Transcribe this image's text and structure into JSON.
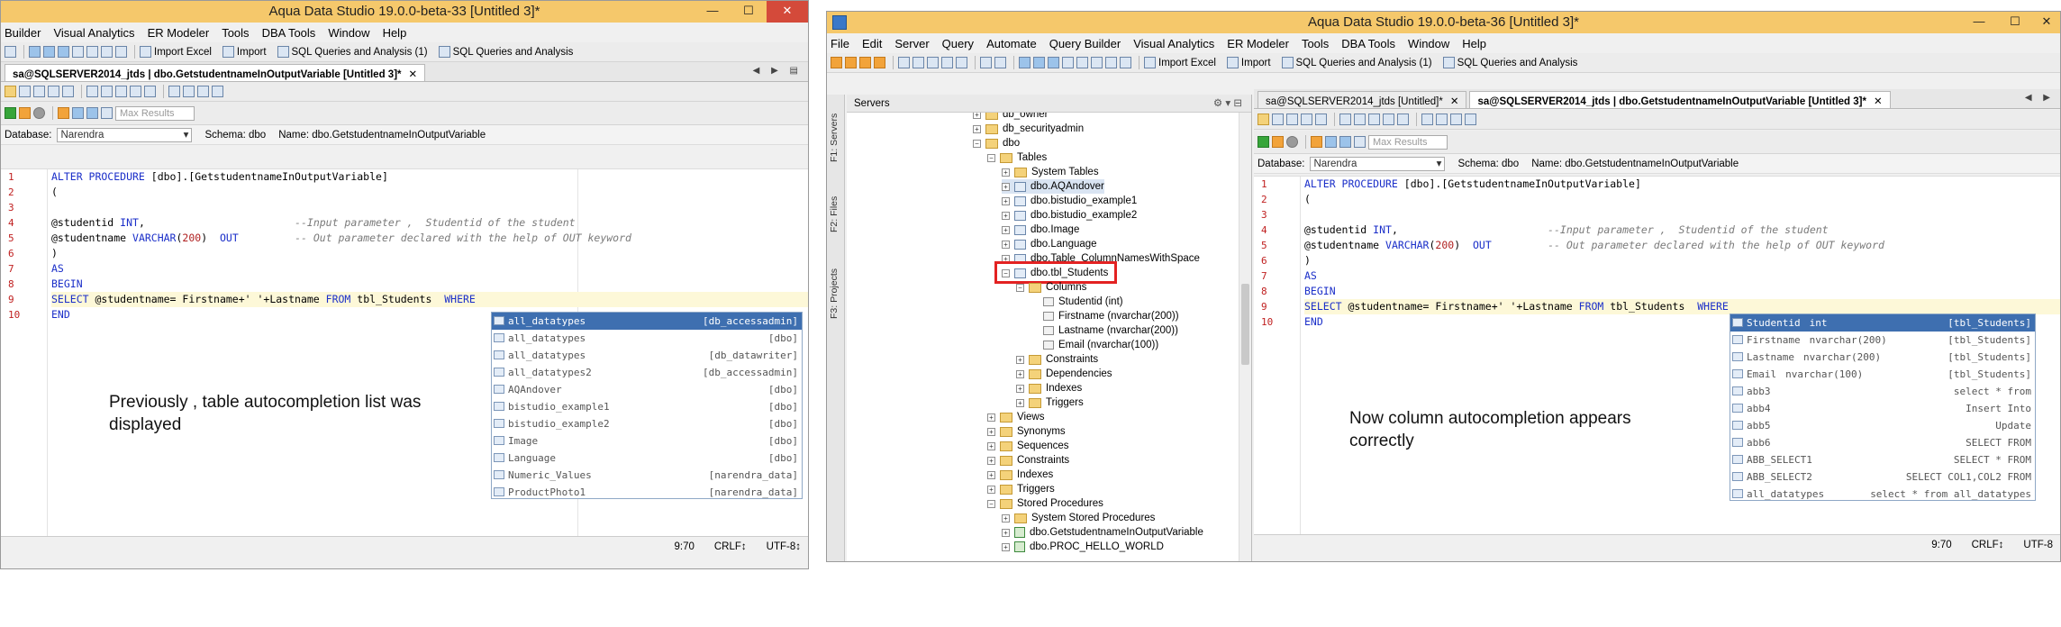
{
  "left": {
    "title": "Aqua Data Studio 19.0.0-beta-33 [Untitled 3]*",
    "menu": [
      "Builder",
      "Visual Analytics",
      "ER Modeler",
      "Tools",
      "DBA Tools",
      "Window",
      "Help"
    ],
    "toolbar_labels": [
      "Import Excel",
      "Import",
      "SQL Queries and Analysis  (1)",
      "SQL Queries and Analysis"
    ],
    "tab": "sa@SQLSERVER2014_jtds | dbo.GetstudentnameInOutputVariable [Untitled 3]*",
    "max_rows_placeholder": "Max Results",
    "database_label": "Database:",
    "database_value": "Narendra",
    "schema": "Schema:  dbo",
    "name": "Name:  dbo.GetstudentnameInOutputVariable",
    "line_numbers": [
      "1",
      "2",
      "3",
      "4",
      "5",
      "6",
      "7",
      "8",
      "9",
      "10"
    ],
    "autocomplete": [
      {
        "name": "all_datatypes",
        "schema": "[db_accessadmin]"
      },
      {
        "name": "all_datatypes",
        "schema": "[dbo]"
      },
      {
        "name": "all_datatypes",
        "schema": "[db_datawriter]"
      },
      {
        "name": "all_datatypes2",
        "schema": "[db_accessadmin]"
      },
      {
        "name": "AQAndover",
        "schema": "[dbo]"
      },
      {
        "name": "bistudio_example1",
        "schema": "[dbo]"
      },
      {
        "name": "bistudio_example2",
        "schema": "[dbo]"
      },
      {
        "name": "Image",
        "schema": "[dbo]"
      },
      {
        "name": "Language",
        "schema": "[dbo]"
      },
      {
        "name": "Numeric_Values",
        "schema": "[narendra_data]"
      },
      {
        "name": "ProductPhoto1",
        "schema": "[narendra_data]"
      }
    ],
    "note": "Previously , table autocompletion list was displayed",
    "status": {
      "pos": "9:70",
      "eol": "CRLF↕",
      "enc": "UTF-8↕"
    }
  },
  "right": {
    "title": "Aqua Data Studio 19.0.0-beta-36 [Untitled 3]*",
    "menu": [
      "File",
      "Edit",
      "Server",
      "Query",
      "Automate",
      "Query Builder",
      "Visual Analytics",
      "ER Modeler",
      "Tools",
      "DBA Tools",
      "Window",
      "Help"
    ],
    "toolbar_labels": [
      "Import Excel",
      "Import",
      "SQL Queries and Analysis  (1)",
      "SQL Queries and Analysis"
    ],
    "side_tabs": [
      "F1: Servers",
      "F2: Files",
      "F3: Projects"
    ],
    "servers_header": "Servers",
    "tree": [
      "db_owner",
      "db_securityadmin",
      "dbo",
      "Tables",
      "System Tables",
      "dbo.AQAndover",
      "dbo.bistudio_example1",
      "dbo.bistudio_example2",
      "dbo.Image",
      "dbo.Language",
      "dbo.Table_ColumnNamesWithSpace",
      "dbo.tbl_Students",
      "Columns",
      "Studentid (int)",
      "Firstname (nvarchar(200))",
      "Lastname (nvarchar(200))",
      "Email (nvarchar(100))",
      "Constraints",
      "Dependencies",
      "Indexes",
      "Triggers",
      "Views",
      "Synonyms",
      "Sequences",
      "Constraints",
      "Indexes",
      "Triggers",
      "Stored Procedures",
      "System Stored Procedures",
      "dbo.GetstudentnameInOutputVariable",
      "dbo.PROC_HELLO_WORLD"
    ],
    "tabs": [
      "sa@SQLSERVER2014_jtds [Untitled]*",
      "sa@SQLSERVER2014_jtds | dbo.GetstudentnameInOutputVariable [Untitled 3]*"
    ],
    "max_rows_placeholder": "Max Results",
    "database_label": "Database:",
    "database_value": "Narendra",
    "schema": "Schema:  dbo",
    "name": "Name:  dbo.GetstudentnameInOutputVariable",
    "line_numbers": [
      "1",
      "2",
      "3",
      "4",
      "5",
      "6",
      "7",
      "8",
      "9",
      "10"
    ],
    "autocomplete": [
      {
        "name": "Studentid",
        "type": "int",
        "right": "[tbl_Students]"
      },
      {
        "name": "Firstname",
        "type": "nvarchar(200)",
        "right": "[tbl_Students]"
      },
      {
        "name": "Lastname",
        "type": "nvarchar(200)",
        "right": "[tbl_Students]"
      },
      {
        "name": "Email",
        "type": "nvarchar(100)",
        "right": "[tbl_Students]"
      },
      {
        "name": "abb3",
        "type": "",
        "right": "select * from"
      },
      {
        "name": "abb4",
        "type": "",
        "right": "Insert Into"
      },
      {
        "name": "abb5",
        "type": "",
        "right": "Update"
      },
      {
        "name": "abb6",
        "type": "",
        "right": "SELECT   FROM"
      },
      {
        "name": "ABB_SELECT1",
        "type": "",
        "right": "SELECT * FROM"
      },
      {
        "name": "ABB_SELECT2",
        "type": "",
        "right": "SELECT COL1,COL2 FROM"
      },
      {
        "name": "all_datatypes",
        "type": "",
        "right": "select * from all_datatypes"
      }
    ],
    "note": "Now column autocompletion appears correctly",
    "status": {
      "pos": "9:70",
      "eol": "CRLF↕",
      "enc": "UTF-8"
    }
  },
  "code": {
    "l1a": "ALTER PROCEDURE",
    "l1b": " [dbo].[GetstudentnameInOutputVariable]",
    "l2": "(",
    "l4a": "@studentid ",
    "l4b": "INT",
    "l4c": ",                        ",
    "l4d": "--Input parameter ,  Studentid of the student",
    "l5a": "@studentname ",
    "l5b": "VARCHAR",
    "l5c": "(",
    "l5d": "200",
    "l5e": ")  ",
    "l5f": "OUT",
    "l5g": "         ",
    "l5h": "-- Out parameter declared with the help of OUT keyword",
    "l6": ")",
    "l7": "AS",
    "l8": "BEGIN",
    "l9a": "SELECT",
    "l9b": " @studentname= Firstname+' '+Lastname ",
    "l9c": "FROM",
    "l9d": " tbl_Students  ",
    "l9e": "WHERE",
    "l10": "END"
  },
  "colors": {
    "titlebar": "#f5c86b",
    "keyword": "#1b2fc9",
    "selection": "#3e6fb0",
    "highlight_box": "#e32222"
  }
}
